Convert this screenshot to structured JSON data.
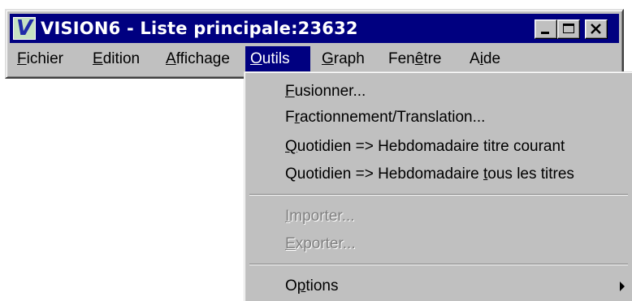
{
  "window": {
    "app_icon_letter": "V",
    "title": "VISION6 - Liste principale:23632"
  },
  "menubar": {
    "items": [
      {
        "accel": "F",
        "rest": "ichier"
      },
      {
        "accel": "E",
        "rest": "dition"
      },
      {
        "accel": "A",
        "rest": "ffichage"
      },
      {
        "accel": "O",
        "rest": "utils"
      },
      {
        "accel": "G",
        "rest": "raph"
      },
      {
        "pre": "Fen",
        "accel": "ê",
        "rest": "tre"
      },
      {
        "pre": "A",
        "accel": "i",
        "rest": "de"
      }
    ],
    "active_index": 3
  },
  "outils_menu": {
    "items": [
      {
        "pre": "",
        "accel": "F",
        "rest": "usionner...",
        "enabled": true
      },
      {
        "pre": "F",
        "accel": "r",
        "rest": "actionnement/Translation...",
        "enabled": true
      },
      {
        "pre": "",
        "accel": "Q",
        "rest": "uotidien => Hebdomadaire titre courant",
        "enabled": true
      },
      {
        "pre": "Quotidien => Hebdomadaire ",
        "accel": "t",
        "rest": "ous les titres",
        "enabled": true
      },
      {
        "pre": "",
        "accel": "I",
        "rest": "mporter...",
        "enabled": false
      },
      {
        "pre": "",
        "accel": "E",
        "rest": "xporter...",
        "enabled": false
      },
      {
        "pre": "O",
        "accel": "p",
        "rest": "tions",
        "enabled": true,
        "has_submenu": true
      }
    ]
  },
  "icons": {
    "minimize": "minimize-icon",
    "maximize": "maximize-icon",
    "close": "close-icon",
    "submenu": "submenu-arrow-icon"
  },
  "colors": {
    "titlebar": "#000080",
    "menu_highlight": "#000080",
    "face": "#c0c0c0",
    "disabled_text": "#808080"
  }
}
